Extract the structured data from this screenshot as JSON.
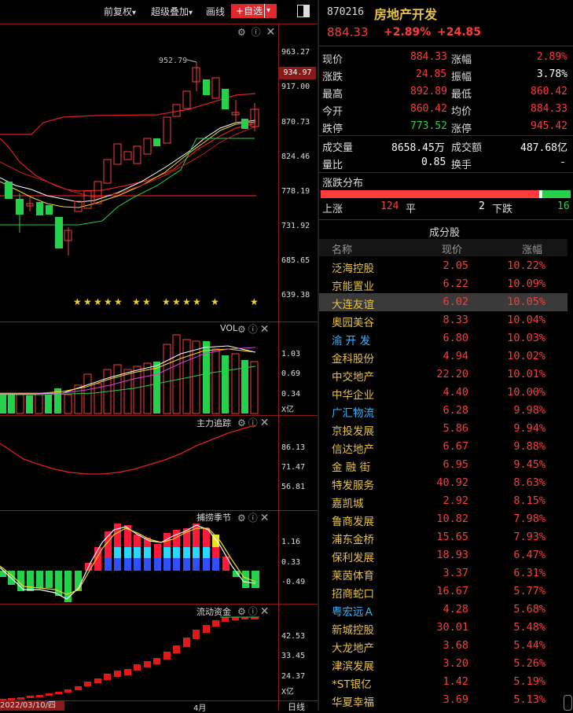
{
  "toolbar": {
    "adjust": "前复权",
    "overlay": "超级叠加",
    "draw": "画线",
    "add_watch": "+自选",
    "adjust_arrow": "▾",
    "overlay_arrow": "▾",
    "add_arrow": "▾"
  },
  "price_chart": {
    "axis": [
      "963.27",
      "917.00",
      "870.73",
      "824.46",
      "778.19",
      "731.92",
      "685.65",
      "639.38"
    ],
    "current_price_tag": "934.97",
    "high_label": "952.79"
  },
  "vol_panel": {
    "title": "VOL",
    "axis": [
      "1.03",
      "0.69",
      "0.34"
    ],
    "unit": "X亿"
  },
  "main_track_panel": {
    "title": "主力追踪",
    "axis": [
      "86.13",
      "71.47",
      "56.81"
    ]
  },
  "season_panel": {
    "title": "捕捞季节",
    "axis": [
      "1.16",
      "0.33",
      "-0.49"
    ]
  },
  "flow_panel": {
    "title": "流动资金",
    "axis": [
      "42.53",
      "33.45",
      "24.37"
    ],
    "unit": "X亿"
  },
  "bottom_axis": {
    "start": "2022/03/10/四",
    "month": "4月",
    "period": "日线"
  },
  "header": {
    "code": "870216",
    "name": "房地产开发",
    "price": "884.33",
    "change_pct": "+2.89%",
    "change": "+24.85"
  },
  "quote": {
    "rows": [
      {
        "l1": "现价",
        "v1": "884.33",
        "l2": "涨幅",
        "v2": "2.89%"
      },
      {
        "l1": "涨跌",
        "v1": "24.85",
        "l2": "振幅",
        "v2": "3.78%"
      },
      {
        "l1": "最高",
        "v1": "892.89",
        "l2": "最低",
        "v2": "860.42"
      },
      {
        "l1": "今开",
        "v1": "860.42",
        "l2": "均价",
        "v2": "884.33"
      },
      {
        "l1": "跌停",
        "v1": "773.52",
        "l2": "涨停",
        "v2": "945.42"
      },
      {
        "l1": "成交量",
        "v1": "8658.45万",
        "l2": "成交额",
        "v2": "487.68亿"
      },
      {
        "l1": "量比",
        "v1": "0.85",
        "l2": "换手",
        "v2": "-"
      }
    ]
  },
  "distribution": {
    "title": "涨跌分布",
    "up_label": "上涨",
    "up_count": "124",
    "flat_label": "平",
    "flat_count": "2",
    "down_label": "下跌",
    "down_count": "16",
    "up_fraction": 0.8732,
    "flat_fraction": 0.0141,
    "down_fraction": 0.1127
  },
  "components": {
    "title": "成分股",
    "col_name": "名称",
    "col_price": "现价",
    "col_change": "涨幅",
    "rows": [
      {
        "name": "泛海控股",
        "price": "2.05",
        "change": "10.22%",
        "color": "#e8c341"
      },
      {
        "name": "京能置业",
        "price": "6.22",
        "change": "10.09%",
        "color": "#e8c341"
      },
      {
        "name": "大连友谊",
        "price": "6.02",
        "change": "10.05%",
        "color": "#e8c341"
      },
      {
        "name": "奥园美谷",
        "price": "8.33",
        "change": "10.04%",
        "color": "#e8c341"
      },
      {
        "name": "渝 开 发",
        "price": "6.80",
        "change": "10.03%",
        "color": "#36b4ff"
      },
      {
        "name": "金科股份",
        "price": "4.94",
        "change": "10.02%",
        "color": "#e8c341"
      },
      {
        "name": "中交地产",
        "price": "22.20",
        "change": "10.01%",
        "color": "#e8c341"
      },
      {
        "name": "中华企业",
        "price": "4.40",
        "change": "10.00%",
        "color": "#e8c341"
      },
      {
        "name": "广汇物流",
        "price": "6.28",
        "change": "9.98%",
        "color": "#36b4ff"
      },
      {
        "name": "京投发展",
        "price": "5.86",
        "change": "9.94%",
        "color": "#e8c341"
      },
      {
        "name": "信达地产",
        "price": "6.67",
        "change": "9.88%",
        "color": "#e8c341"
      },
      {
        "name": "金 融 街",
        "price": "6.95",
        "change": "9.45%",
        "color": "#e8c341"
      },
      {
        "name": "特发服务",
        "price": "40.92",
        "change": "8.63%",
        "color": "#e8c341"
      },
      {
        "name": "嘉凯城",
        "price": "2.92",
        "change": "8.15%",
        "color": "#e8c341"
      },
      {
        "name": "鲁商发展",
        "price": "10.82",
        "change": "7.98%",
        "color": "#e8c341"
      },
      {
        "name": "浦东金桥",
        "price": "15.65",
        "change": "7.93%",
        "color": "#e8c341"
      },
      {
        "name": "保利发展",
        "price": "18.93",
        "change": "6.47%",
        "color": "#e8c341"
      },
      {
        "name": "莱茵体育",
        "price": "3.37",
        "change": "6.31%",
        "color": "#e8c341"
      },
      {
        "name": "招商蛇口",
        "price": "16.67",
        "change": "5.77%",
        "color": "#e8c341"
      },
      {
        "name": "粤宏远Ａ",
        "price": "4.28",
        "change": "5.68%",
        "color": "#36b4ff"
      },
      {
        "name": "新城控股",
        "price": "30.01",
        "change": "5.48%",
        "color": "#e8c341"
      },
      {
        "name": "大龙地产",
        "price": "3.68",
        "change": "5.44%",
        "color": "#e8c341"
      },
      {
        "name": "津滨发展",
        "price": "3.20",
        "change": "5.26%",
        "color": "#e8c341"
      },
      {
        "name": "*ST银亿",
        "price": "1.42",
        "change": "5.19%",
        "color": "#e8c341"
      },
      {
        "name": "华夏幸福",
        "price": "3.69",
        "change": "5.13%",
        "color": "#e8c341"
      }
    ],
    "selected_index": 2
  },
  "colors": {
    "up": "#ff3b3b",
    "down": "#27d04b",
    "accent": "#e8c341",
    "watch": "#e0282e"
  },
  "icons": [
    "gear-icon",
    "help-icon",
    "close-icon",
    "panel-toggle-icon"
  ]
}
